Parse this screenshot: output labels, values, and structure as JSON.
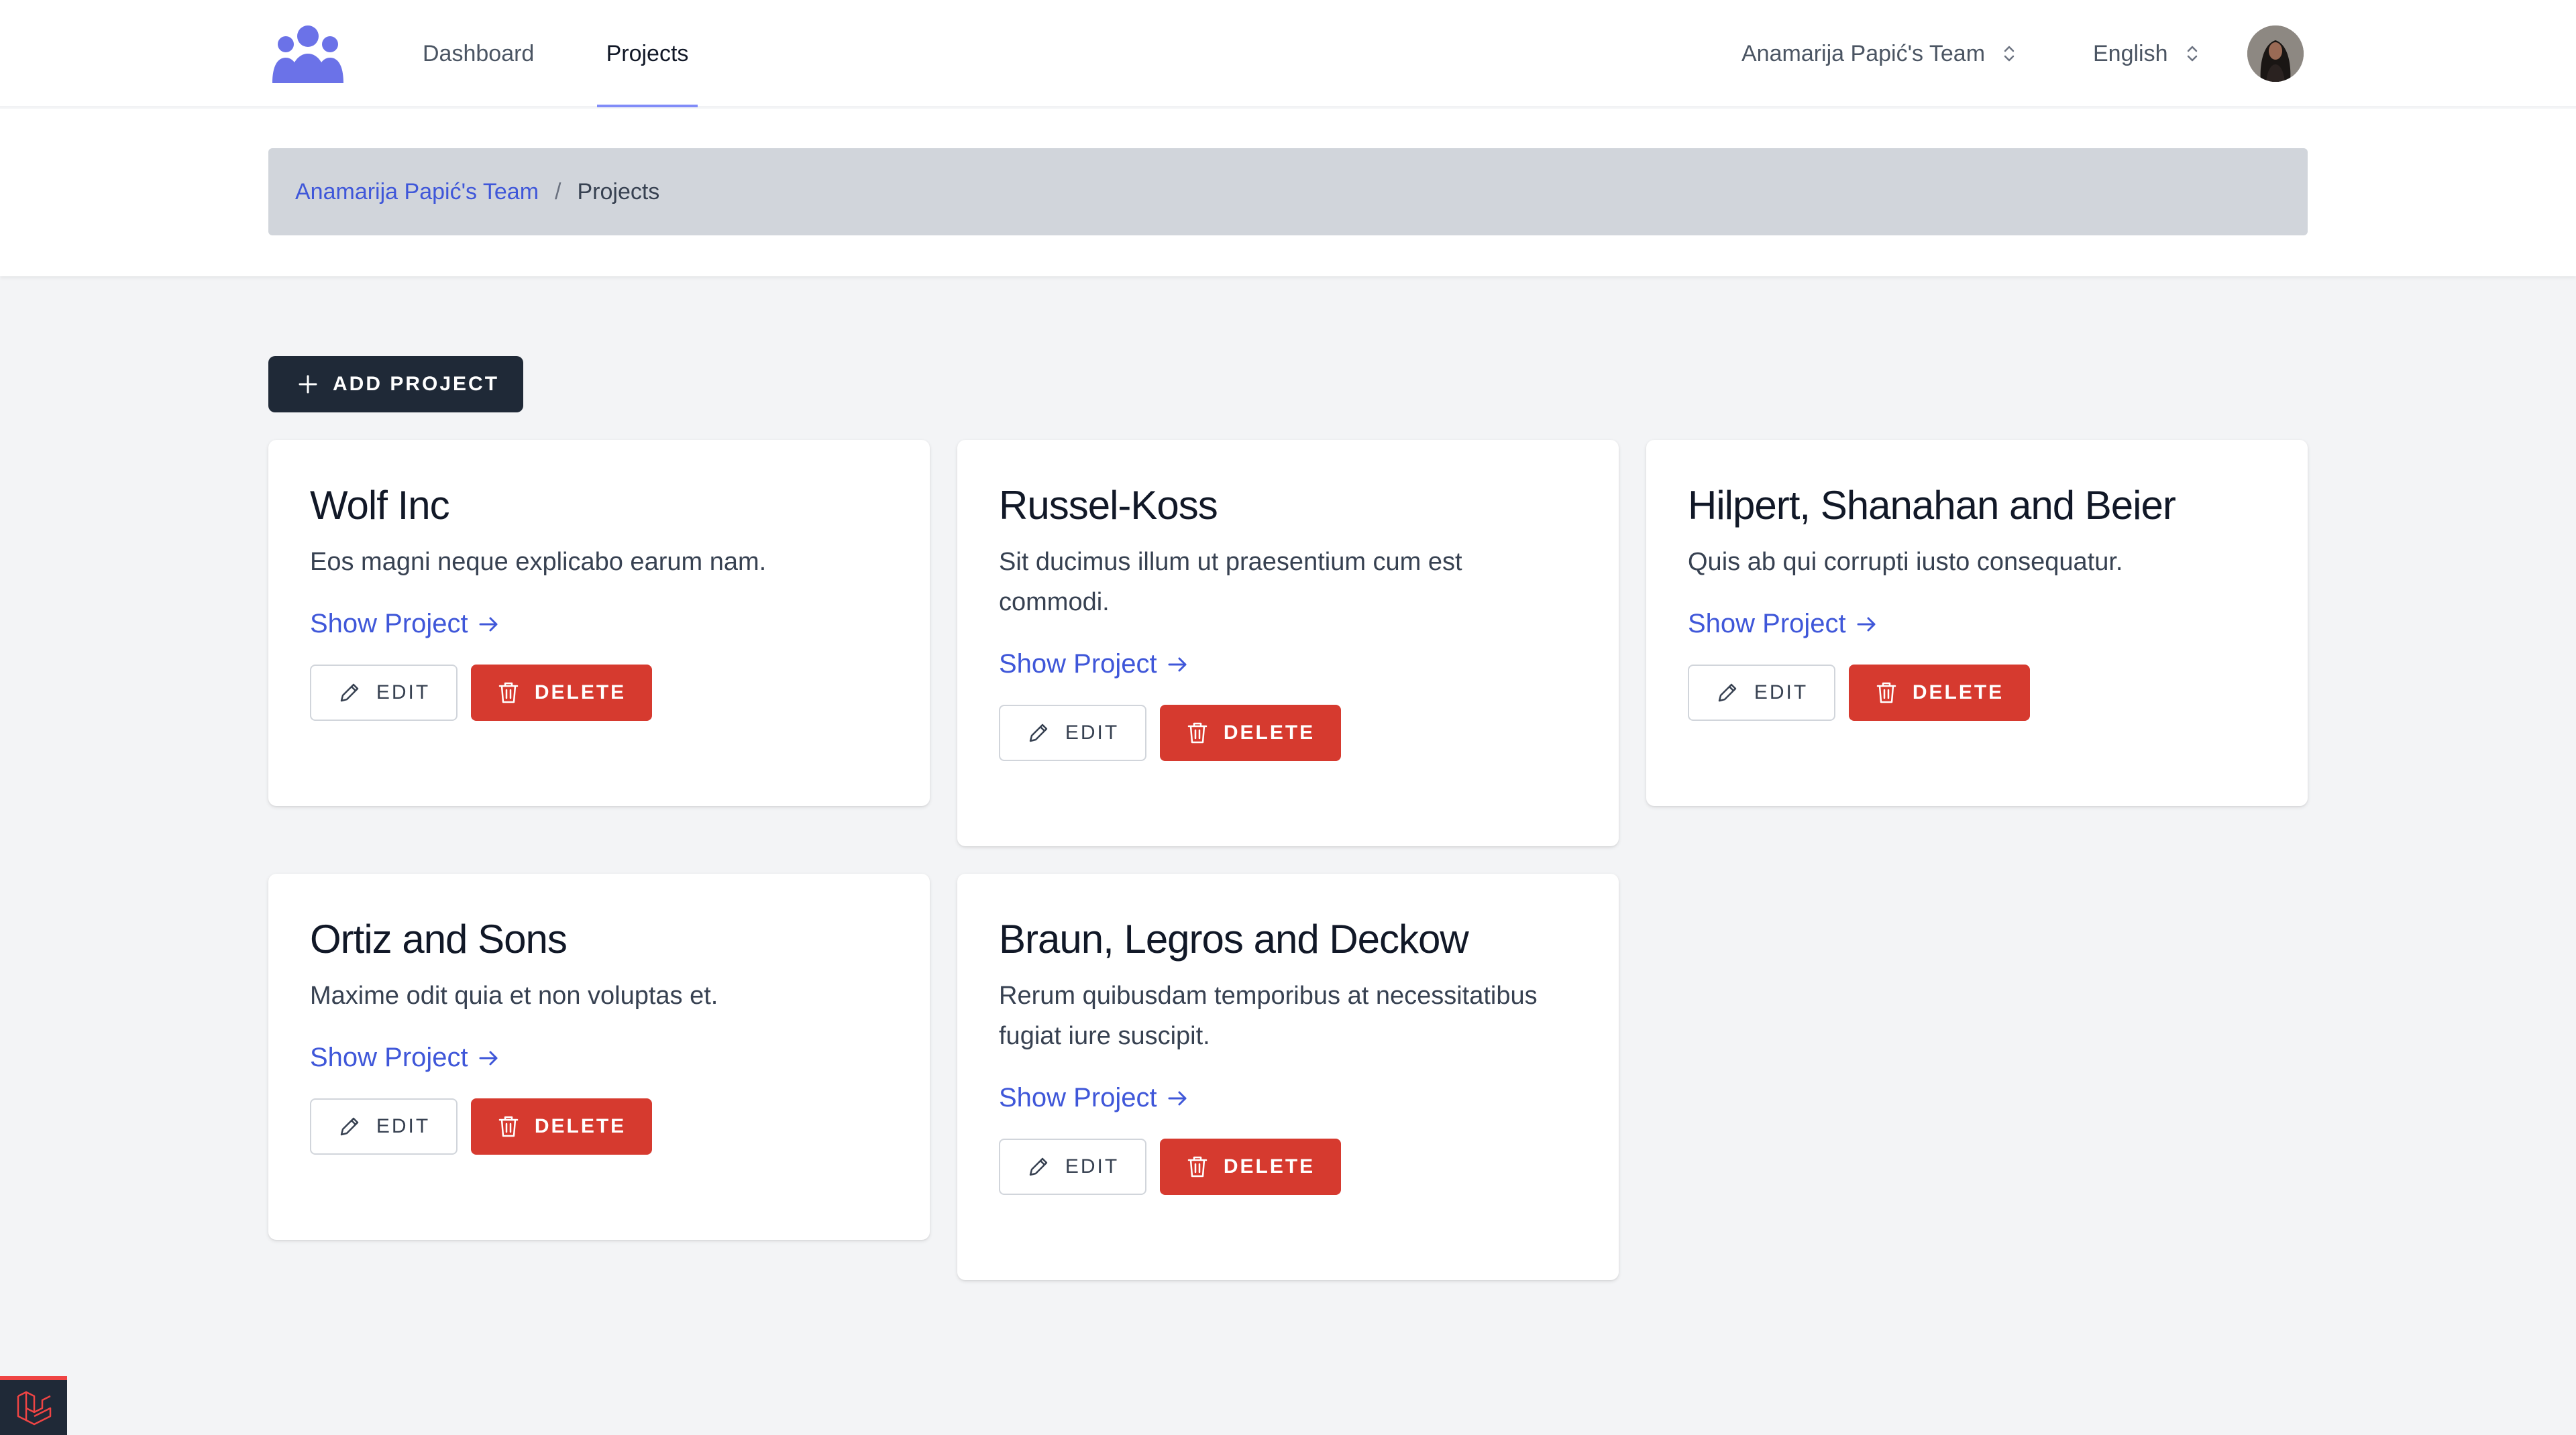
{
  "nav": {
    "links": [
      {
        "label": "Dashboard"
      },
      {
        "label": "Projects",
        "active": true
      }
    ],
    "team_dropdown": "Anamarija Papić's Team",
    "language_dropdown": "English",
    "accent_color": "#818cf8"
  },
  "breadcrumb": {
    "team": "Anamarija Papić's Team",
    "separator": "/",
    "current": "Projects"
  },
  "actions": {
    "add_project": "ADD PROJECT"
  },
  "card_labels": {
    "show": "Show Project",
    "edit": "EDIT",
    "delete": "DELETE"
  },
  "projects": [
    {
      "title": "Wolf Inc",
      "description": "Eos magni neque explicabo earum nam."
    },
    {
      "title": "Russel-Koss",
      "description": "Sit ducimus illum ut praesentium cum est commodi."
    },
    {
      "title": "Hilpert, Shanahan and Beier",
      "description": "Quis ab qui corrupti iusto consequatur."
    },
    {
      "title": "Ortiz and Sons",
      "description": "Maxime odit quia et non voluptas et."
    },
    {
      "title": "Braun, Legros and Deckow",
      "description": "Rerum quibusdam temporibus at necessitatibus fugiat iure suscipit."
    }
  ],
  "colors": {
    "primary_dark": "#1f2937",
    "danger": "#d63a2f",
    "link": "#3f57d9",
    "logo": "#6b72e8"
  },
  "icons": [
    "team-logo-icon",
    "chevron-updown-icon",
    "plus-icon",
    "arrow-right-icon",
    "pencil-icon",
    "trash-icon",
    "laravel-icon"
  ]
}
